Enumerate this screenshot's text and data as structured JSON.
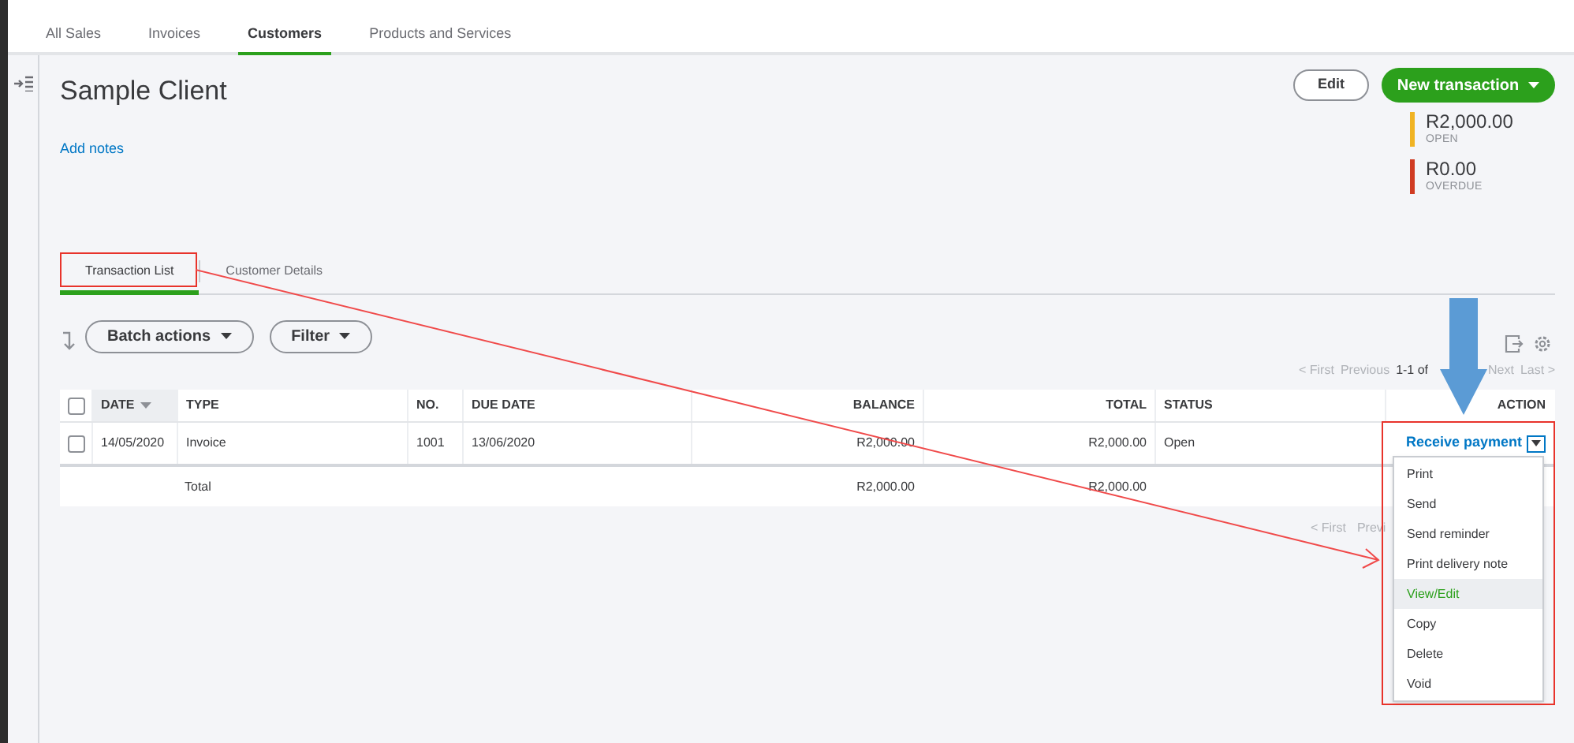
{
  "top_tabs": [
    {
      "label": "All Sales",
      "selected": false
    },
    {
      "label": "Invoices",
      "selected": false
    },
    {
      "label": "Customers",
      "selected": true
    },
    {
      "label": "Products and Services",
      "selected": false
    }
  ],
  "customer": {
    "name": "Sample Client",
    "add_notes": "Add notes"
  },
  "edit_button": "Edit",
  "new_transaction_button": "New transaction",
  "summary": [
    {
      "amount": "R2,000.00",
      "label": "OPEN",
      "color": "#f0b323"
    },
    {
      "amount": "R0.00",
      "label": "OVERDUE",
      "color": "#d03b22"
    }
  ],
  "detail_tabs": [
    {
      "label": "Transaction List",
      "selected": true
    },
    {
      "label": "Customer Details",
      "selected": false
    }
  ],
  "toolbar": {
    "batch_actions": "Batch actions",
    "filter": "Filter"
  },
  "pagination_top": [
    "< First",
    "Previous",
    "1-1 of",
    "Next",
    "Last >"
  ],
  "table": {
    "select_all_checked": false,
    "columns": [
      {
        "label": "DATE",
        "sorted": true
      },
      {
        "label": "TYPE",
        "sorted": false
      },
      {
        "label": "NO.",
        "sorted": false
      },
      {
        "label": "DUE DATE",
        "sorted": false
      },
      {
        "label": "BALANCE",
        "sorted": false
      },
      {
        "label": "TOTAL",
        "sorted": false
      },
      {
        "label": "STATUS",
        "sorted": false
      },
      {
        "label": "ACTION",
        "sorted": false
      }
    ],
    "rows": [
      {
        "checked": false,
        "cells": [
          "14/05/2020",
          "Invoice",
          "1001",
          "13/06/2020",
          "R2,000.00",
          "R2,000.00",
          "Open"
        ],
        "action": "Receive payment"
      }
    ],
    "total_row": {
      "label": "Total",
      "balance": "R2,000.00",
      "total": "R2,000.00"
    }
  },
  "pagination_bottom": [
    "< First",
    "Previ"
  ],
  "action_menu": [
    {
      "label": "Print",
      "highlighted": false
    },
    {
      "label": "Send",
      "highlighted": false
    },
    {
      "label": "Send reminder",
      "highlighted": false
    },
    {
      "label": "Print delivery note",
      "highlighted": false
    },
    {
      "label": "View/Edit",
      "highlighted": true
    },
    {
      "label": "Copy",
      "highlighted": false
    },
    {
      "label": "Delete",
      "highlighted": false
    },
    {
      "label": "Void",
      "highlighted": false
    }
  ]
}
